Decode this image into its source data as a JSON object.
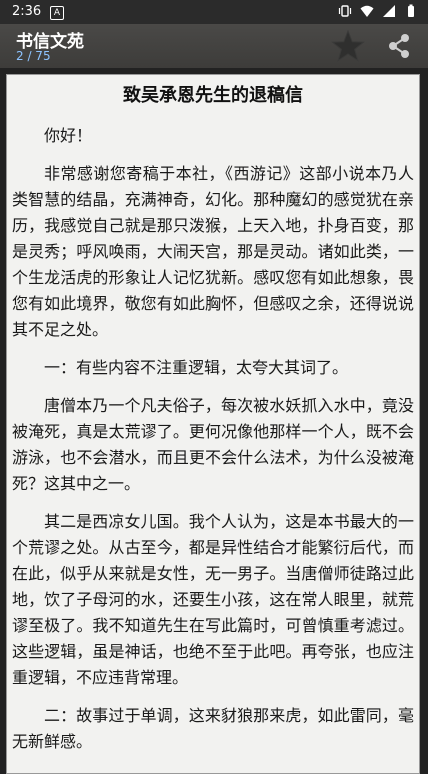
{
  "status_bar": {
    "time": "2:36",
    "notification_letter": "A"
  },
  "app_bar": {
    "title": "书信文苑",
    "page_indicator": "2 / 75"
  },
  "icons": [
    "star-icon",
    "share-icon",
    "vibrate-icon",
    "wifi-icon",
    "signal-icon",
    "battery-icon"
  ],
  "colors": {
    "page_indicator": "#8ec4ff",
    "paper": "#f2f2f0",
    "app_bar": "#444341"
  },
  "letter": {
    "title": "致吴承恩先生的退稿信",
    "paragraphs": [
      "你好！",
      "非常感谢您寄稿于本社，《西游记》这部小说本乃人类智慧的结晶，充满神奇，幻化。那种魔幻的感觉犹在亲历，我感觉自己就是那只泼猴，上天入地，扑身百变，那是灵秀；呼风唤雨，大闹天宫，那是灵动。诸如此类，一个生龙活虎的形象让人记忆犹新。感叹您有如此想象，畏您有如此境界，敬您有如此胸怀，但感叹之余，还得说说其不足之处。",
      "一：有些内容不注重逻辑，太夸大其词了。",
      "唐僧本乃一个凡夫俗子，每次被水妖抓入水中，竟没被淹死，真是太荒谬了。更何况像他那样一个人，既不会游泳，也不会潜水，而且更不会什么法术，为什么没被淹死？这其中之一。",
      "其二是西凉女儿国。我个人认为，这是本书最大的一个荒谬之处。从古至今，都是异性结合才能繁衍后代，而在此，似乎从来就是女性，无一男子。当唐僧师徒路过此地，饮了子母河的水，还要生小孩，这在常人眼里，就荒谬至极了。我不知道先生在写此篇时，可曾慎重考滤过。这些逻辑，虽是神话，也绝不至于此吧。再夸张，也应注重逻辑，不应违背常理。",
      "二：故事过于单调，这来豺狼那来虎，如此雷同，毫无新鲜感。"
    ]
  }
}
